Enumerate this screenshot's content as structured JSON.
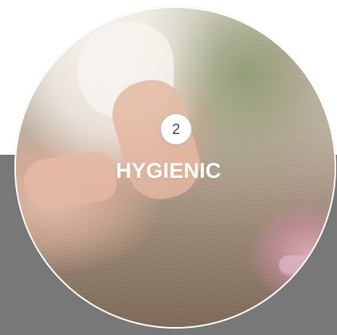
{
  "card": {
    "step_number": "2",
    "title": "HYGIENIC"
  },
  "colors": {
    "background": "#ffffff",
    "panel": "#787878",
    "title_text": "#ffffff",
    "badge_bg": "#ffffff",
    "badge_text": "#444444"
  }
}
